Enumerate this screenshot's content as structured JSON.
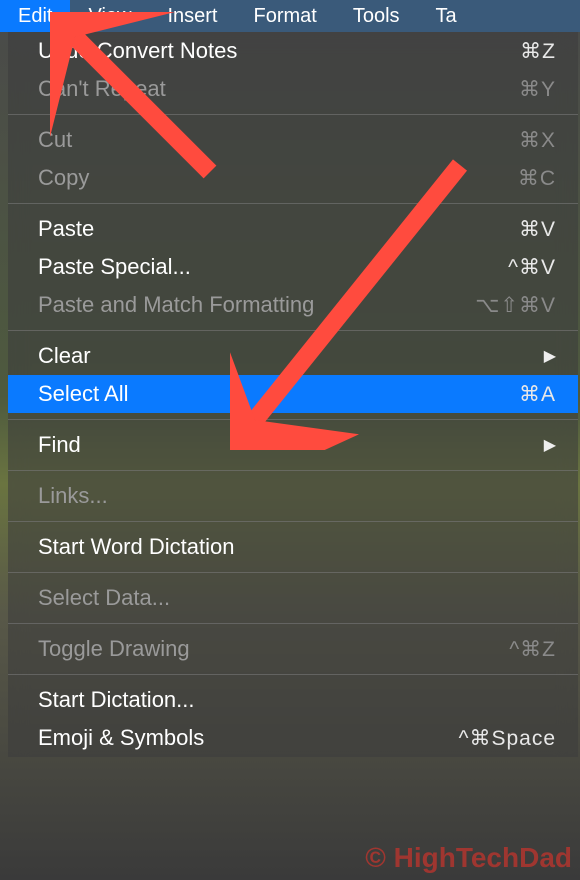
{
  "menubar": {
    "items": [
      {
        "label": "Edit",
        "active": true
      },
      {
        "label": "View",
        "active": false
      },
      {
        "label": "Insert",
        "active": false
      },
      {
        "label": "Format",
        "active": false
      },
      {
        "label": "Tools",
        "active": false
      },
      {
        "label": "Ta",
        "active": false
      }
    ]
  },
  "menu": [
    {
      "label": "Undo Convert Notes",
      "shortcut": "⌘Z",
      "enabled": true
    },
    {
      "label": "Can't Repeat",
      "shortcut": "⌘Y",
      "enabled": false
    },
    {
      "sep": true
    },
    {
      "label": "Cut",
      "shortcut": "⌘X",
      "enabled": false
    },
    {
      "label": "Copy",
      "shortcut": "⌘C",
      "enabled": false
    },
    {
      "sep": true
    },
    {
      "label": "Paste",
      "shortcut": "⌘V",
      "enabled": true
    },
    {
      "label": "Paste Special...",
      "shortcut": "^⌘V",
      "enabled": true
    },
    {
      "label": "Paste and Match Formatting",
      "shortcut": "⌥⇧⌘V",
      "enabled": false
    },
    {
      "sep": true
    },
    {
      "label": "Clear",
      "submenu": true,
      "enabled": true
    },
    {
      "label": "Select All",
      "shortcut": "⌘A",
      "enabled": true,
      "highlighted": true
    },
    {
      "sep": true
    },
    {
      "label": "Find",
      "submenu": true,
      "enabled": true
    },
    {
      "sep": true
    },
    {
      "label": "Links...",
      "enabled": false
    },
    {
      "sep": true
    },
    {
      "label": "Start Word Dictation",
      "enabled": true
    },
    {
      "sep": true
    },
    {
      "label": "Select Data...",
      "enabled": false
    },
    {
      "sep": true
    },
    {
      "label": "Toggle Drawing",
      "shortcut": "^⌘Z",
      "enabled": false
    },
    {
      "sep": true
    },
    {
      "label": "Start Dictation...",
      "enabled": true
    },
    {
      "label": "Emoji & Symbols",
      "shortcut": "^⌘Space",
      "enabled": true
    }
  ],
  "watermark": "© HighTechDad",
  "annotations": {
    "arrow_color": "#ff4b3e"
  }
}
